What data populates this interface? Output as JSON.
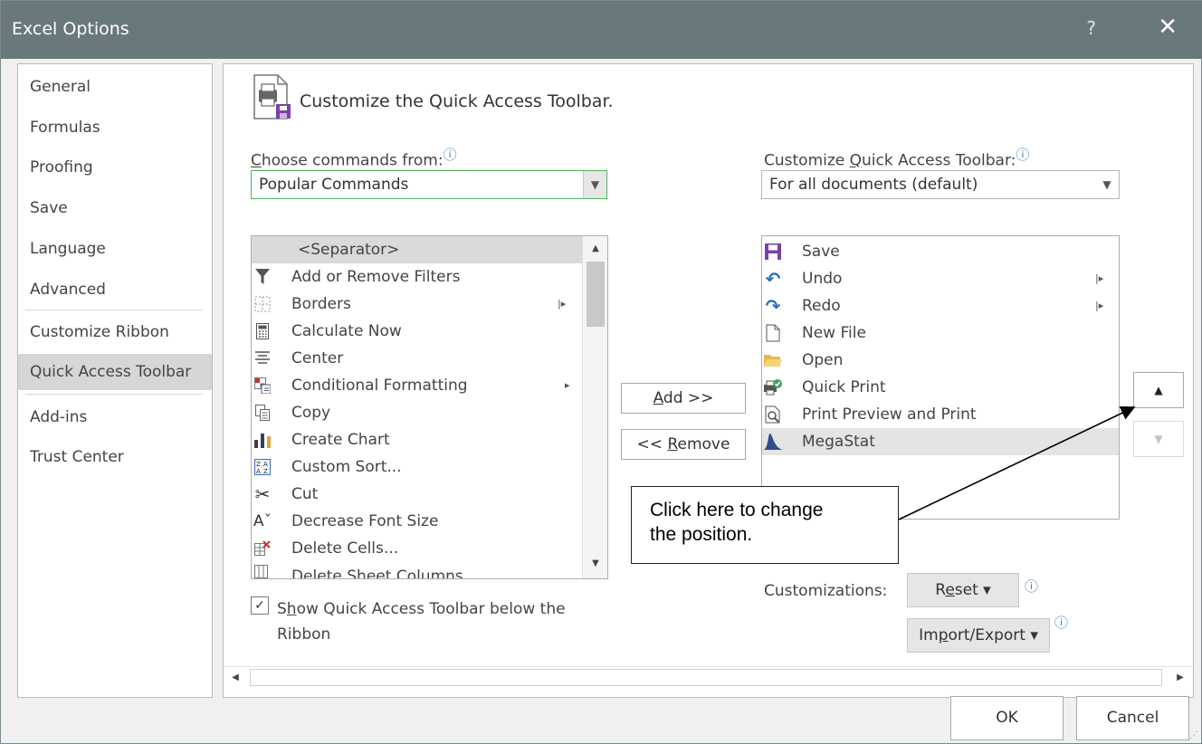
{
  "window": {
    "title": "Excel Options",
    "help_glyph": "?",
    "close_glyph": "✕"
  },
  "nav": {
    "items": [
      {
        "label": "General"
      },
      {
        "label": "Formulas"
      },
      {
        "label": "Proofing"
      },
      {
        "label": "Save"
      },
      {
        "label": "Language"
      },
      {
        "label": "Advanced"
      },
      {
        "label": "Customize Ribbon"
      },
      {
        "label": "Quick Access Toolbar",
        "active": true
      },
      {
        "label": "Add-ins"
      },
      {
        "label": "Trust Center"
      }
    ]
  },
  "header": {
    "title": "Customize the Quick Access Toolbar."
  },
  "choose": {
    "label_pre": "",
    "label_accel": "C",
    "label_post": "hoose commands from:",
    "info_glyph": "ⓘ",
    "value": "Popular Commands"
  },
  "customize": {
    "label_pre": "Customize ",
    "label_accel": "Q",
    "label_post": "uick Access Toolbar:",
    "info_glyph": "ⓘ",
    "value": "For all documents (default)"
  },
  "commands": [
    {
      "label": "<Separator>",
      "icon": "separator",
      "selected": true
    },
    {
      "label": "Add or Remove Filters",
      "icon": "filter-icon"
    },
    {
      "label": "Borders",
      "icon": "borders-icon",
      "submenu": true
    },
    {
      "label": "Calculate Now",
      "icon": "calculator-icon"
    },
    {
      "label": "Center",
      "icon": "align-center-icon"
    },
    {
      "label": "Conditional Formatting",
      "icon": "conditional-formatting-icon",
      "submenu": true
    },
    {
      "label": "Copy",
      "icon": "copy-icon"
    },
    {
      "label": "Create Chart",
      "icon": "chart-icon"
    },
    {
      "label": "Custom Sort...",
      "icon": "sort-icon"
    },
    {
      "label": "Cut",
      "icon": "scissors-icon"
    },
    {
      "label": "Decrease Font Size",
      "icon": "decrease-font-icon"
    },
    {
      "label": "Delete Cells...",
      "icon": "delete-cells-icon"
    },
    {
      "label": "Delete Sheet Columns",
      "icon": "delete-columns-icon"
    }
  ],
  "toolbar_items": [
    {
      "label": "Save",
      "icon": "save-icon"
    },
    {
      "label": "Undo",
      "icon": "undo-icon",
      "submenu": true
    },
    {
      "label": "Redo",
      "icon": "redo-icon",
      "submenu": true
    },
    {
      "label": "New File",
      "icon": "new-file-icon"
    },
    {
      "label": "Open",
      "icon": "folder-icon"
    },
    {
      "label": "Quick Print",
      "icon": "quick-print-icon"
    },
    {
      "label": "Print Preview and Print",
      "icon": "print-preview-icon"
    },
    {
      "label": "MegaStat",
      "icon": "megastat-icon",
      "highlighted": true
    }
  ],
  "buttons": {
    "add_pre": "",
    "add_accel": "A",
    "add_post": "dd >>",
    "remove_pre": "<< ",
    "remove_accel": "R",
    "remove_post": "emove",
    "move_up_glyph": "▲",
    "move_down_glyph": "▼",
    "reset_pre": "R",
    "reset_accel": "e",
    "reset_post": "set ▾",
    "import_pre": "Im",
    "import_accel": "p",
    "import_post": "ort/Export ▾",
    "ok": "OK",
    "cancel": "Cancel"
  },
  "customizations_label": "Customizations:",
  "show_below": {
    "checked": true,
    "check_glyph": "✓",
    "label_pre": "S",
    "label_accel": "h",
    "label_post": "ow Quick Access Toolbar below the",
    "label_line2": "Ribbon"
  },
  "callout": {
    "line1": "Click here to change",
    "line2": "the position."
  },
  "colors": {
    "titlebar": "#69787a",
    "nav_active": "#d6d6d6",
    "select_focus": "#54b05d",
    "info_icon": "#3b83c4",
    "save_icon": "#7b3fa6",
    "undo_redo_icon": "#2b6fc0"
  }
}
